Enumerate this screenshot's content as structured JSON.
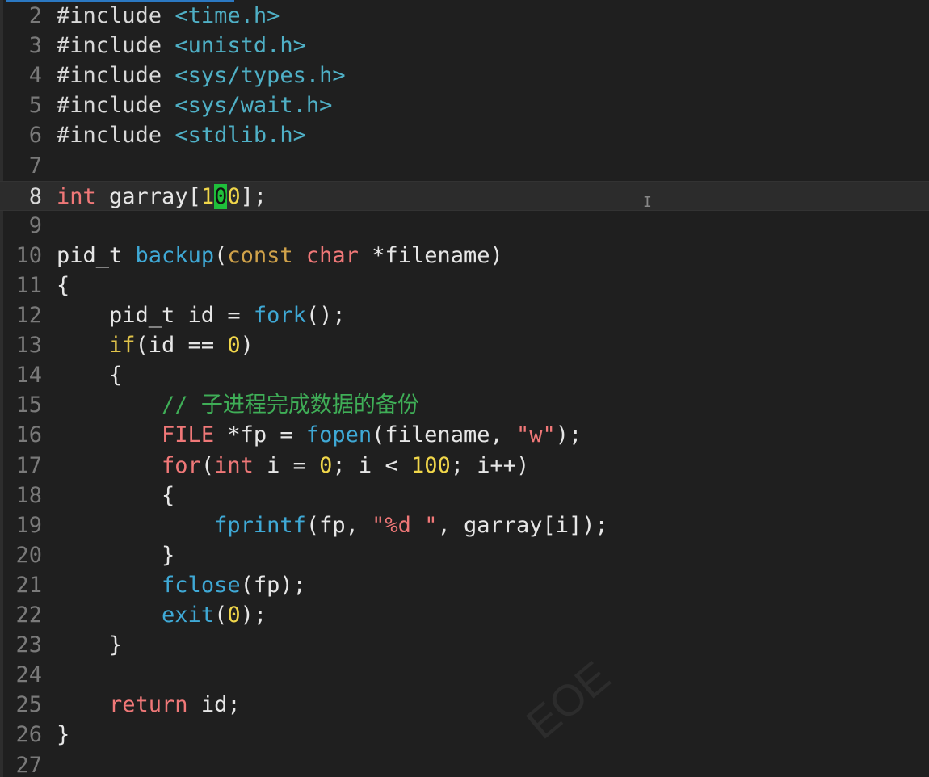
{
  "editor": {
    "current_line": "8",
    "lines": [
      {
        "n": "2",
        "segs": [
          [
            "#include ",
            "kw-pre"
          ],
          [
            "<time.h>",
            "inc"
          ]
        ]
      },
      {
        "n": "3",
        "segs": [
          [
            "#include ",
            "kw-pre"
          ],
          [
            "<unistd.h>",
            "inc"
          ]
        ]
      },
      {
        "n": "4",
        "segs": [
          [
            "#include ",
            "kw-pre"
          ],
          [
            "<sys/types.h>",
            "inc"
          ]
        ]
      },
      {
        "n": "5",
        "segs": [
          [
            "#include ",
            "kw-pre"
          ],
          [
            "<sys/wait.h>",
            "inc"
          ]
        ]
      },
      {
        "n": "6",
        "segs": [
          [
            "#include ",
            "kw-pre"
          ],
          [
            "<stdlib.h>",
            "inc"
          ]
        ]
      },
      {
        "n": "7",
        "segs": []
      },
      {
        "n": "8",
        "segs": [
          [
            "int",
            "type"
          ],
          [
            " garray[",
            ""
          ],
          [
            "1",
            "num"
          ],
          [
            "0",
            "cursor-block"
          ],
          [
            "0",
            "num"
          ],
          [
            "];",
            ""
          ]
        ]
      },
      {
        "n": "9",
        "segs": []
      },
      {
        "n": "10",
        "segs": [
          [
            "pid_t ",
            ""
          ],
          [
            "backup",
            "fn"
          ],
          [
            "(",
            ""
          ],
          [
            "const",
            "kw2"
          ],
          [
            " ",
            ""
          ],
          [
            "char",
            "type"
          ],
          [
            " *filename)",
            ""
          ]
        ]
      },
      {
        "n": "11",
        "segs": [
          [
            "{",
            ""
          ]
        ]
      },
      {
        "n": "12",
        "segs": [
          [
            "    pid_t id = ",
            ""
          ],
          [
            "fork",
            "fn"
          ],
          [
            "();",
            ""
          ]
        ]
      },
      {
        "n": "13",
        "segs": [
          [
            "    ",
            ""
          ],
          [
            "if",
            "kw"
          ],
          [
            "(id == ",
            ""
          ],
          [
            "0",
            "num"
          ],
          [
            ")",
            ""
          ]
        ]
      },
      {
        "n": "14",
        "segs": [
          [
            "    {",
            ""
          ]
        ]
      },
      {
        "n": "15",
        "segs": [
          [
            "        ",
            ""
          ],
          [
            "// 子进程完成数据的备份",
            "cmt"
          ]
        ]
      },
      {
        "n": "16",
        "segs": [
          [
            "        ",
            ""
          ],
          [
            "FILE",
            "type"
          ],
          [
            " *fp = ",
            ""
          ],
          [
            "fopen",
            "fn"
          ],
          [
            "(filename, ",
            ""
          ],
          [
            "\"w\"",
            "str"
          ],
          [
            ");",
            ""
          ]
        ]
      },
      {
        "n": "17",
        "segs": [
          [
            "        ",
            ""
          ],
          [
            "for",
            "type"
          ],
          [
            "(",
            ""
          ],
          [
            "int",
            "type"
          ],
          [
            " i = ",
            ""
          ],
          [
            "0",
            "num"
          ],
          [
            "; i < ",
            ""
          ],
          [
            "100",
            "num"
          ],
          [
            "; i++)",
            ""
          ]
        ]
      },
      {
        "n": "18",
        "segs": [
          [
            "        {",
            ""
          ]
        ]
      },
      {
        "n": "19",
        "segs": [
          [
            "            ",
            ""
          ],
          [
            "fprintf",
            "fn"
          ],
          [
            "(fp, ",
            ""
          ],
          [
            "\"",
            "str"
          ],
          [
            "%d",
            "str-fmt"
          ],
          [
            " \"",
            "str"
          ],
          [
            ", garray[i]);",
            ""
          ]
        ]
      },
      {
        "n": "20",
        "segs": [
          [
            "        }",
            ""
          ]
        ]
      },
      {
        "n": "21",
        "segs": [
          [
            "        ",
            ""
          ],
          [
            "fclose",
            "fn"
          ],
          [
            "(fp);",
            ""
          ]
        ]
      },
      {
        "n": "22",
        "segs": [
          [
            "        ",
            ""
          ],
          [
            "exit",
            "fn"
          ],
          [
            "(",
            ""
          ],
          [
            "0",
            "num"
          ],
          [
            ");",
            ""
          ]
        ]
      },
      {
        "n": "23",
        "segs": [
          [
            "    }",
            ""
          ]
        ]
      },
      {
        "n": "24",
        "segs": []
      },
      {
        "n": "25",
        "segs": [
          [
            "    ",
            ""
          ],
          [
            "return",
            "type"
          ],
          [
            " id;",
            ""
          ]
        ]
      },
      {
        "n": "26",
        "segs": [
          [
            "}",
            ""
          ]
        ]
      },
      {
        "n": "27",
        "segs": []
      }
    ]
  },
  "overlay": {
    "ibeam_glyph": "I",
    "watermark_text": "EOE"
  }
}
